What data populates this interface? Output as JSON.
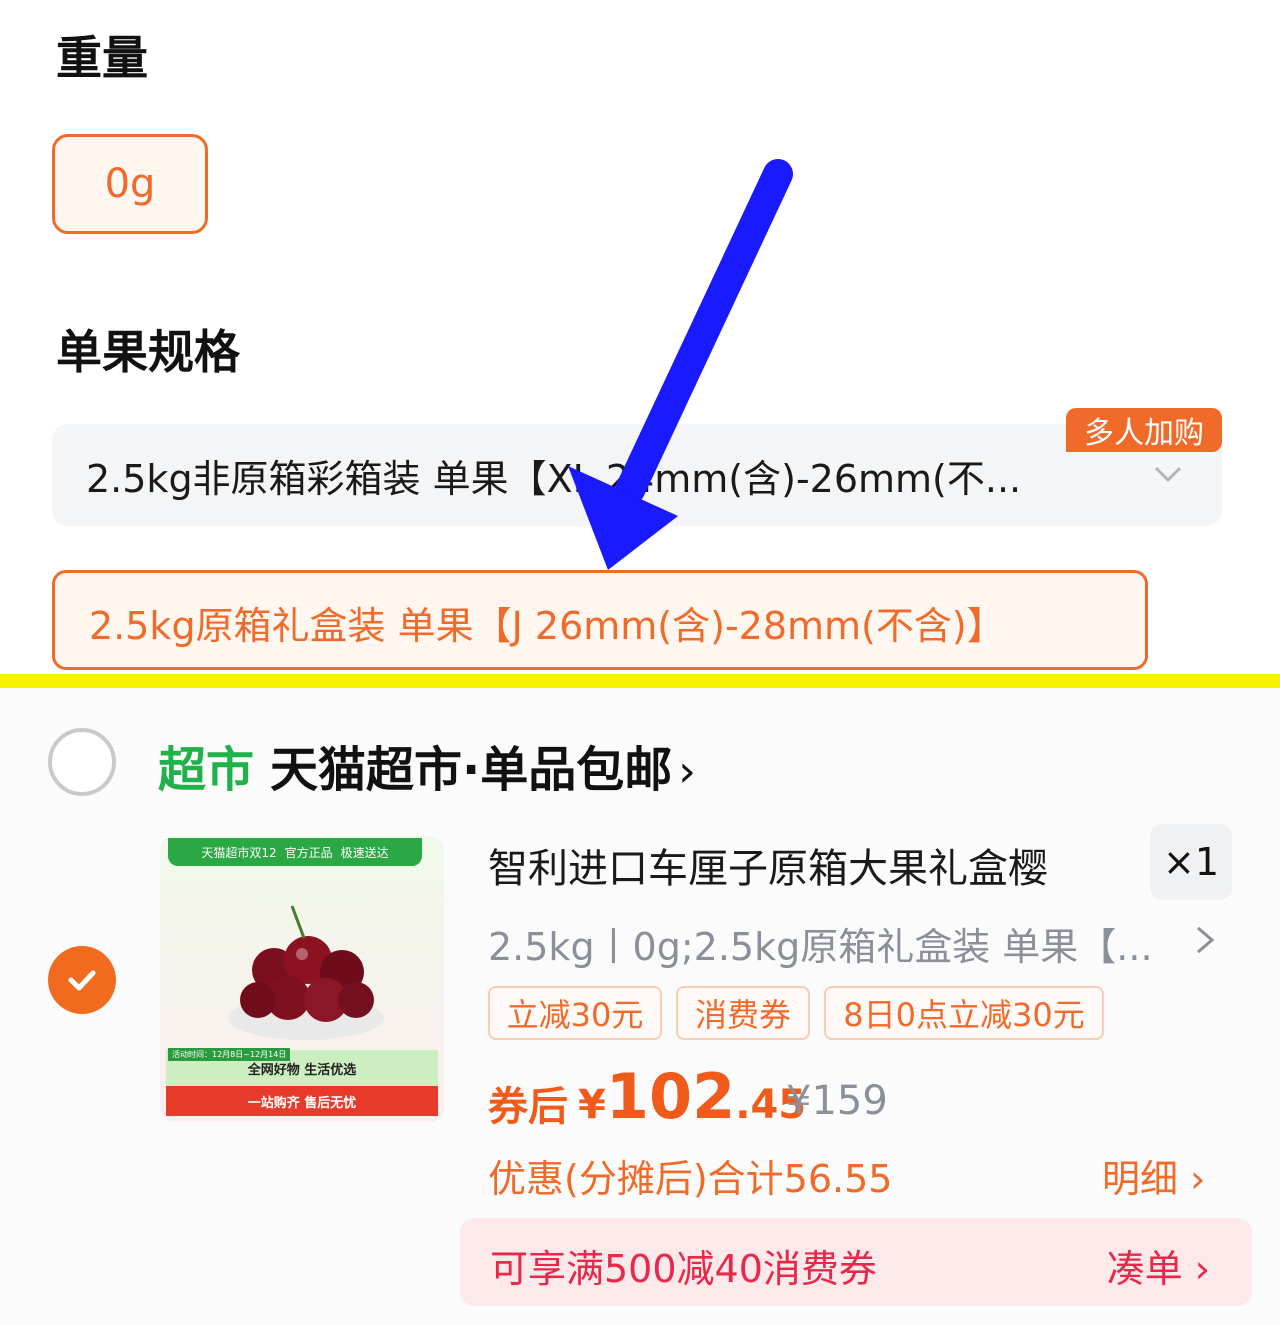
{
  "spec": {
    "weight_title": "重量",
    "weight_value": "0g",
    "size_title": "单果规格",
    "option_1": "2.5kg非原箱彩箱装 单果【XL 24mm(含)-26mm(不...",
    "option_1_badge": "多人加购",
    "option_2": "2.5kg原箱礼盒装 单果【J 26mm(含)-28mm(不含)】"
  },
  "store": {
    "tag": "超市",
    "name": "天猫超市·单品包邮",
    "chevron": "›"
  },
  "product": {
    "image": {
      "top_bar": [
        "天猫超市双12",
        "官方正品",
        "极速送达"
      ],
      "date": "活动时间：12月8日~12月14日",
      "banner_green": "全网好物 生活优选",
      "banner_red": "一站购齐 售后无忧"
    },
    "title": "智利进口车厘子原箱大果礼盒樱",
    "quantity": "×1",
    "spec": "2.5kg丨0g;2.5kg原箱礼盒装 单果【...",
    "promo_tags": [
      "立减30元",
      "消费券",
      "8日0点立减30元"
    ],
    "price_prefix": "券后",
    "price_yen": "¥",
    "price_int": "102",
    "price_dec": ".45",
    "price_original": "¥159",
    "discount_text": "优惠(分摊后)合计56.55",
    "detail_label": "明细 ›",
    "coupon_text": "可享满500减40消费券",
    "coupon_action": "凑单 ›"
  },
  "colors": {
    "accent_orange": "#f06a2a",
    "store_green": "#21b14a",
    "arrow_blue": "#1a1aff",
    "divider_yellow": "#f7f200",
    "coupon_red": "#e8284a"
  }
}
